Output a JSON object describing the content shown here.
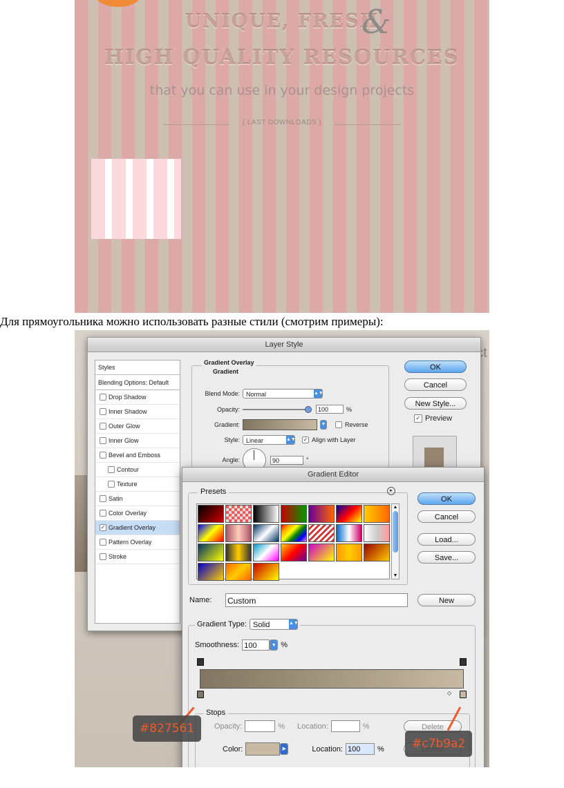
{
  "banner": {
    "line1": "UNIQUE, FRESH",
    "ampersand": "&",
    "line2": "HIGH QUALITY RESOURCES",
    "subtitle": "that you can use in your design projects",
    "downloads": "( LAST DOWNLOADS )"
  },
  "caption": "Для прямоугольника можно использовать разные стили (смотрим примеры):",
  "layer_style": {
    "title": "Layer Style",
    "styles_header": "Styles",
    "blending": "Blending Options: Default",
    "items": [
      {
        "label": "Drop Shadow",
        "checked": false,
        "indent": false,
        "selected": false
      },
      {
        "label": "Inner Shadow",
        "checked": false,
        "indent": false,
        "selected": false
      },
      {
        "label": "Outer Glow",
        "checked": false,
        "indent": false,
        "selected": false
      },
      {
        "label": "Inner Glow",
        "checked": false,
        "indent": false,
        "selected": false
      },
      {
        "label": "Bevel and Emboss",
        "checked": false,
        "indent": false,
        "selected": false
      },
      {
        "label": "Contour",
        "checked": false,
        "indent": true,
        "selected": false
      },
      {
        "label": "Texture",
        "checked": false,
        "indent": true,
        "selected": false
      },
      {
        "label": "Satin",
        "checked": false,
        "indent": false,
        "selected": false
      },
      {
        "label": "Color Overlay",
        "checked": false,
        "indent": false,
        "selected": false
      },
      {
        "label": "Gradient Overlay",
        "checked": true,
        "indent": false,
        "selected": true
      },
      {
        "label": "Pattern Overlay",
        "checked": false,
        "indent": false,
        "selected": false
      },
      {
        "label": "Stroke",
        "checked": false,
        "indent": false,
        "selected": false
      }
    ],
    "group_title": "Gradient Overlay",
    "group_sub": "Gradient",
    "blend_mode_label": "Blend Mode:",
    "blend_mode": "Normal",
    "opacity_label": "Opacity:",
    "opacity": "100",
    "percent": "%",
    "gradient_label": "Gradient:",
    "reverse": "Reverse",
    "style_label": "Style:",
    "style": "Linear",
    "align": "Align with Layer",
    "angle_label": "Angle:",
    "angle": "90",
    "degree": "°",
    "ok": "OK",
    "cancel": "Cancel",
    "new_style": "New Style...",
    "preview": "Preview",
    "bg_text": "ect"
  },
  "gradient_editor": {
    "title": "Gradient Editor",
    "presets_label": "Presets",
    "ok": "OK",
    "cancel": "Cancel",
    "load": "Load...",
    "save": "Save...",
    "name_label": "Name:",
    "name_value": "Custom",
    "new": "New",
    "type_label": "Gradient Type:",
    "type_value": "Solid",
    "smooth_label": "Smoothness:",
    "smooth_value": "100",
    "percent": "%",
    "stops_label": "Stops",
    "opacity_label": "Opacity:",
    "location_label": "Location:",
    "delete": "Delete",
    "color_label": "Color:",
    "location_value": "100"
  },
  "callouts": {
    "left": "#827561",
    "right": "#c7b9a2"
  },
  "colors": {
    "gradient_start": "#827561",
    "gradient_end": "#c7b9a2",
    "accent": "#ef5a2c"
  }
}
